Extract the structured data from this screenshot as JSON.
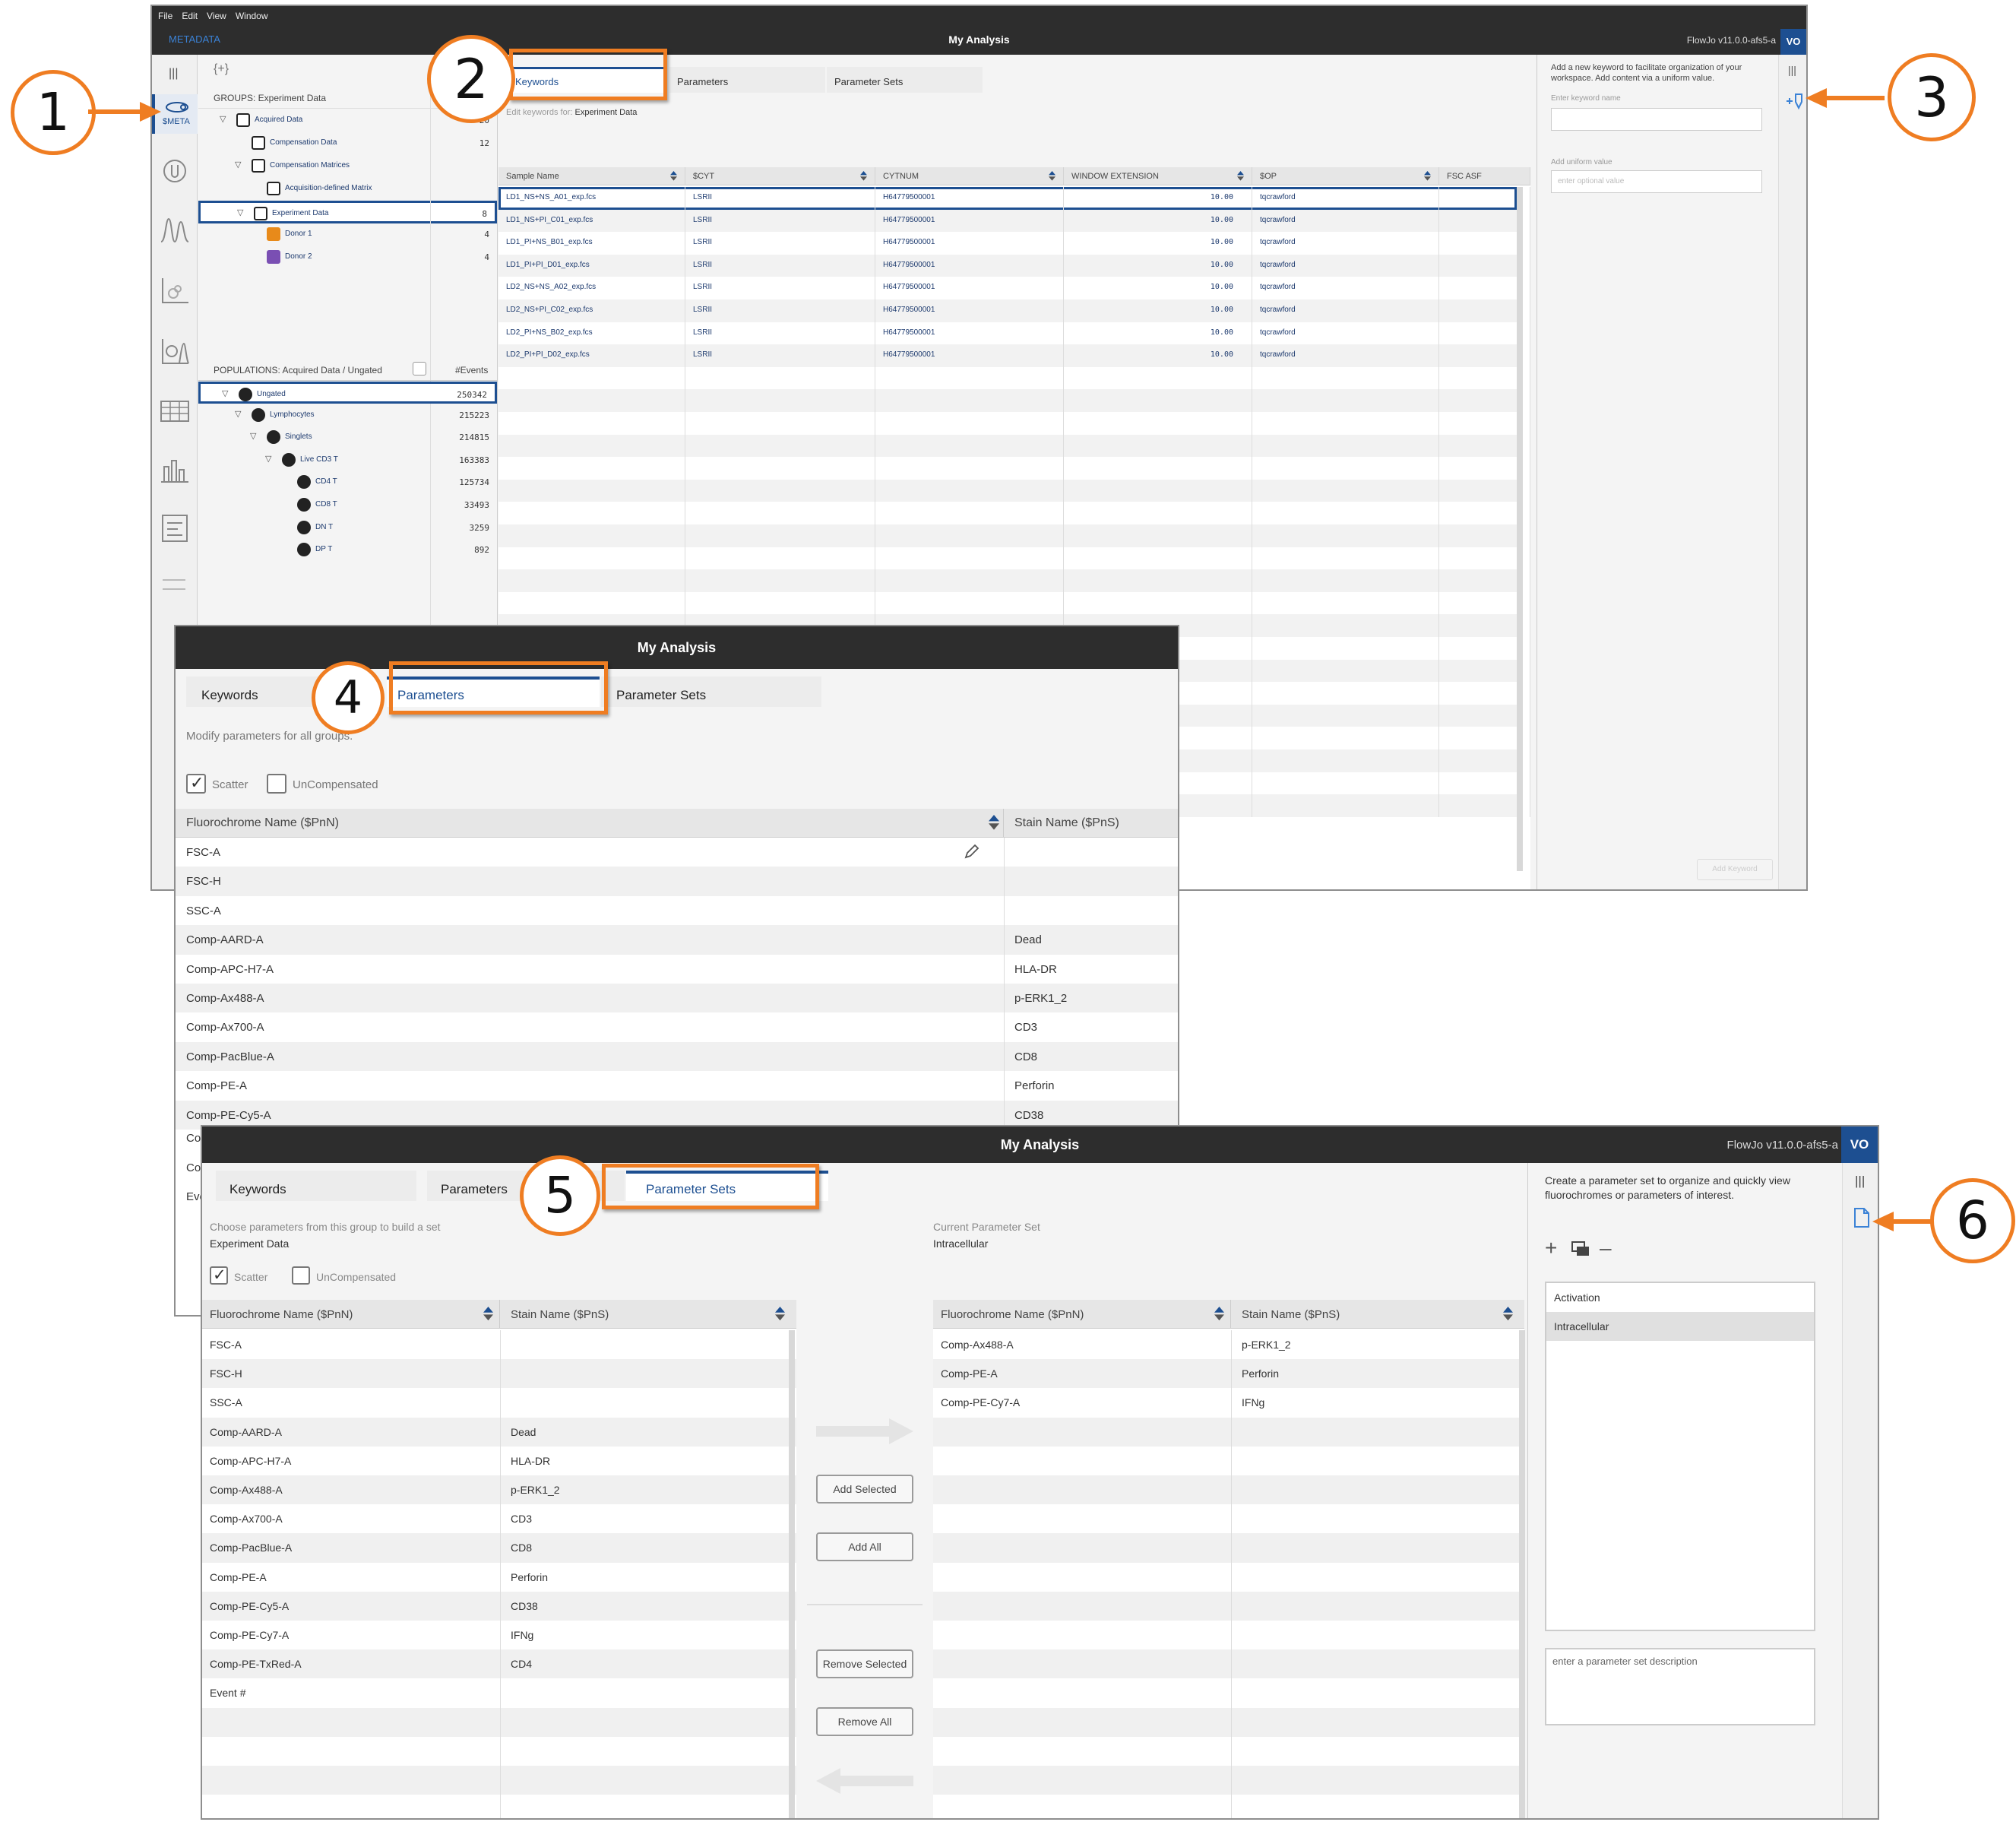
{
  "win1": {
    "menu": [
      "File",
      "Edit",
      "View",
      "Window"
    ],
    "metadata_label": "METADATA",
    "title": "My Analysis",
    "version": "FlowJo v11.0.0-afs5-a",
    "avatar": "VO",
    "meta_nav_label": "$META",
    "add_group_label": "{+}",
    "groups_header": "GROUPS: Experiment Data",
    "groups": [
      {
        "name": "Acquired Data",
        "count": "20",
        "level": 1,
        "expander": true,
        "icon": "group-icon",
        "icon_color": "#222"
      },
      {
        "name": "Compensation Data",
        "count": "12",
        "level": 2,
        "expander": false,
        "icon": "group-icon",
        "icon_color": "#222"
      },
      {
        "name": "Compensation Matrices",
        "count": "",
        "level": 2,
        "expander": true,
        "icon": "matrix-icon",
        "icon_color": "#222"
      },
      {
        "name": "Acquisition-defined Matrix",
        "count": "",
        "level": 3,
        "expander": false,
        "icon": "matrix-icon",
        "icon_color": "#222"
      },
      {
        "name": "Experiment Data",
        "count": "8",
        "level": 2,
        "expander": true,
        "icon": "group-icon",
        "icon_color": "#222",
        "selected": true
      },
      {
        "name": "Donor 1",
        "count": "4",
        "level": 3,
        "expander": false,
        "icon": "group-icon",
        "icon_color": "#e88a1a"
      },
      {
        "name": "Donor 2",
        "count": "4",
        "level": 3,
        "expander": false,
        "icon": "group-icon",
        "icon_color": "#7a4fb3"
      }
    ],
    "populations_header": "POPULATIONS: Acquired Data / Ungated",
    "events_header": "#Events",
    "populations": [
      {
        "name": "Ungated",
        "count": "250342",
        "level": 1,
        "expander": true,
        "selected": true
      },
      {
        "name": "Lymphocytes",
        "count": "215223",
        "level": 2,
        "expander": true
      },
      {
        "name": "Singlets",
        "count": "214815",
        "level": 3,
        "expander": true
      },
      {
        "name": "Live CD3 T",
        "count": "163383",
        "level": 4,
        "expander": true
      },
      {
        "name": "CD4 T",
        "count": "125734",
        "level": 5,
        "expander": false
      },
      {
        "name": "CD8 T",
        "count": "33493",
        "level": 5,
        "expander": false
      },
      {
        "name": "DN T",
        "count": "3259",
        "level": 5,
        "expander": false
      },
      {
        "name": "DP T",
        "count": "892",
        "level": 5,
        "expander": false
      }
    ],
    "tabs": [
      "Keywords",
      "Parameters",
      "Parameter Sets"
    ],
    "edit_prefix": "Edit keywords for:",
    "edit_group": "Experiment Data",
    "columns": [
      "Sample Name",
      "$CYT",
      "CYTNUM",
      "WINDOW EXTENSION",
      "$OP",
      "FSC ASF"
    ],
    "rows": [
      [
        "LD1_NS+NS_A01_exp.fcs",
        "LSRII",
        "H64779500001",
        "10.00",
        "tqcrawford",
        ""
      ],
      [
        "LD1_NS+PI_C01_exp.fcs",
        "LSRII",
        "H64779500001",
        "10.00",
        "tqcrawford",
        ""
      ],
      [
        "LD1_PI+NS_B01_exp.fcs",
        "LSRII",
        "H64779500001",
        "10.00",
        "tqcrawford",
        ""
      ],
      [
        "LD1_PI+PI_D01_exp.fcs",
        "LSRII",
        "H64779500001",
        "10.00",
        "tqcrawford",
        ""
      ],
      [
        "LD2_NS+NS_A02_exp.fcs",
        "LSRII",
        "H64779500001",
        "10.00",
        "tqcrawford",
        ""
      ],
      [
        "LD2_NS+PI_C02_exp.fcs",
        "LSRII",
        "H64779500001",
        "10.00",
        "tqcrawford",
        ""
      ],
      [
        "LD2_PI+NS_B02_exp.fcs",
        "LSRII",
        "H64779500001",
        "10.00",
        "tqcrawford",
        ""
      ],
      [
        "LD2_PI+PI_D02_exp.fcs",
        "LSRII",
        "H64779500001",
        "10.00",
        "tqcrawford",
        ""
      ]
    ],
    "right_help": "Add a new keyword to facilitate organization of your workspace. Add content via a uniform value.",
    "keyword_name_label": "Enter keyword name",
    "uniform_label": "Add uniform value",
    "uniform_placeholder": "enter optional value",
    "add_keyword": "Add Keyword"
  },
  "win2": {
    "title": "My Analysis",
    "tabs": [
      "Keywords",
      "Parameters",
      "Parameter Sets"
    ],
    "hint": "Modify parameters for all groups.",
    "scatter": "Scatter",
    "uncompensated": "UnCompensated",
    "columns": [
      "Fluorochrome Name ($PnN)",
      "Stain Name ($PnS)"
    ],
    "rows": [
      [
        "FSC-A",
        ""
      ],
      [
        "FSC-H",
        ""
      ],
      [
        "SSC-A",
        ""
      ],
      [
        "Comp-AARD-A",
        "Dead"
      ],
      [
        "Comp-APC-H7-A",
        "HLA-DR"
      ],
      [
        "Comp-Ax488-A",
        "p-ERK1_2"
      ],
      [
        "Comp-Ax700-A",
        "CD3"
      ],
      [
        "Comp-PacBlue-A",
        "CD8"
      ],
      [
        "Comp-PE-A",
        "Perforin"
      ],
      [
        "Comp-PE-Cy5-A",
        "CD38"
      ]
    ],
    "peek": [
      "Co",
      "Co",
      "Eve"
    ]
  },
  "win3": {
    "title": "My Analysis",
    "version": "FlowJo v11.0.0-afs5-a",
    "avatar": "VO",
    "tabs": [
      "Keywords",
      "Parameters",
      "Parameter Sets"
    ],
    "choose_hint": "Choose parameters from this group to build a set",
    "group_name": "Experiment Data",
    "current_label": "Current Parameter Set",
    "current_name": "Intracellular",
    "scatter": "Scatter",
    "uncompensated": "UnCompensated",
    "columns": [
      "Fluorochrome Name ($PnN)",
      "Stain Name ($PnS)"
    ],
    "left_rows": [
      [
        "FSC-A",
        ""
      ],
      [
        "FSC-H",
        ""
      ],
      [
        "SSC-A",
        ""
      ],
      [
        "Comp-AARD-A",
        "Dead"
      ],
      [
        "Comp-APC-H7-A",
        "HLA-DR"
      ],
      [
        "Comp-Ax488-A",
        "p-ERK1_2"
      ],
      [
        "Comp-Ax700-A",
        "CD3"
      ],
      [
        "Comp-PacBlue-A",
        "CD8"
      ],
      [
        "Comp-PE-A",
        "Perforin"
      ],
      [
        "Comp-PE-Cy5-A",
        "CD38"
      ],
      [
        "Comp-PE-Cy7-A",
        "IFNg"
      ],
      [
        "Comp-PE-TxRed-A",
        "CD4"
      ],
      [
        "Event #",
        ""
      ]
    ],
    "right_rows": [
      [
        "Comp-Ax488-A",
        "p-ERK1_2"
      ],
      [
        "Comp-PE-A",
        "Perforin"
      ],
      [
        "Comp-PE-Cy7-A",
        "IFNg"
      ]
    ],
    "buttons": [
      "Add Selected",
      "Add All",
      "Remove Selected",
      "Remove All"
    ],
    "help": "Create a parameter set to organize and quickly view fluorochromes or parameters of interest.",
    "sets": [
      "Activation",
      "Intracellular"
    ],
    "selected_set": "Intracellular",
    "description_placeholder": "enter a parameter set description"
  },
  "callouts": [
    "1",
    "2",
    "3",
    "4",
    "5",
    "6"
  ],
  "accent_color": "#ef7d22",
  "brand_blue": "#1d4f91"
}
